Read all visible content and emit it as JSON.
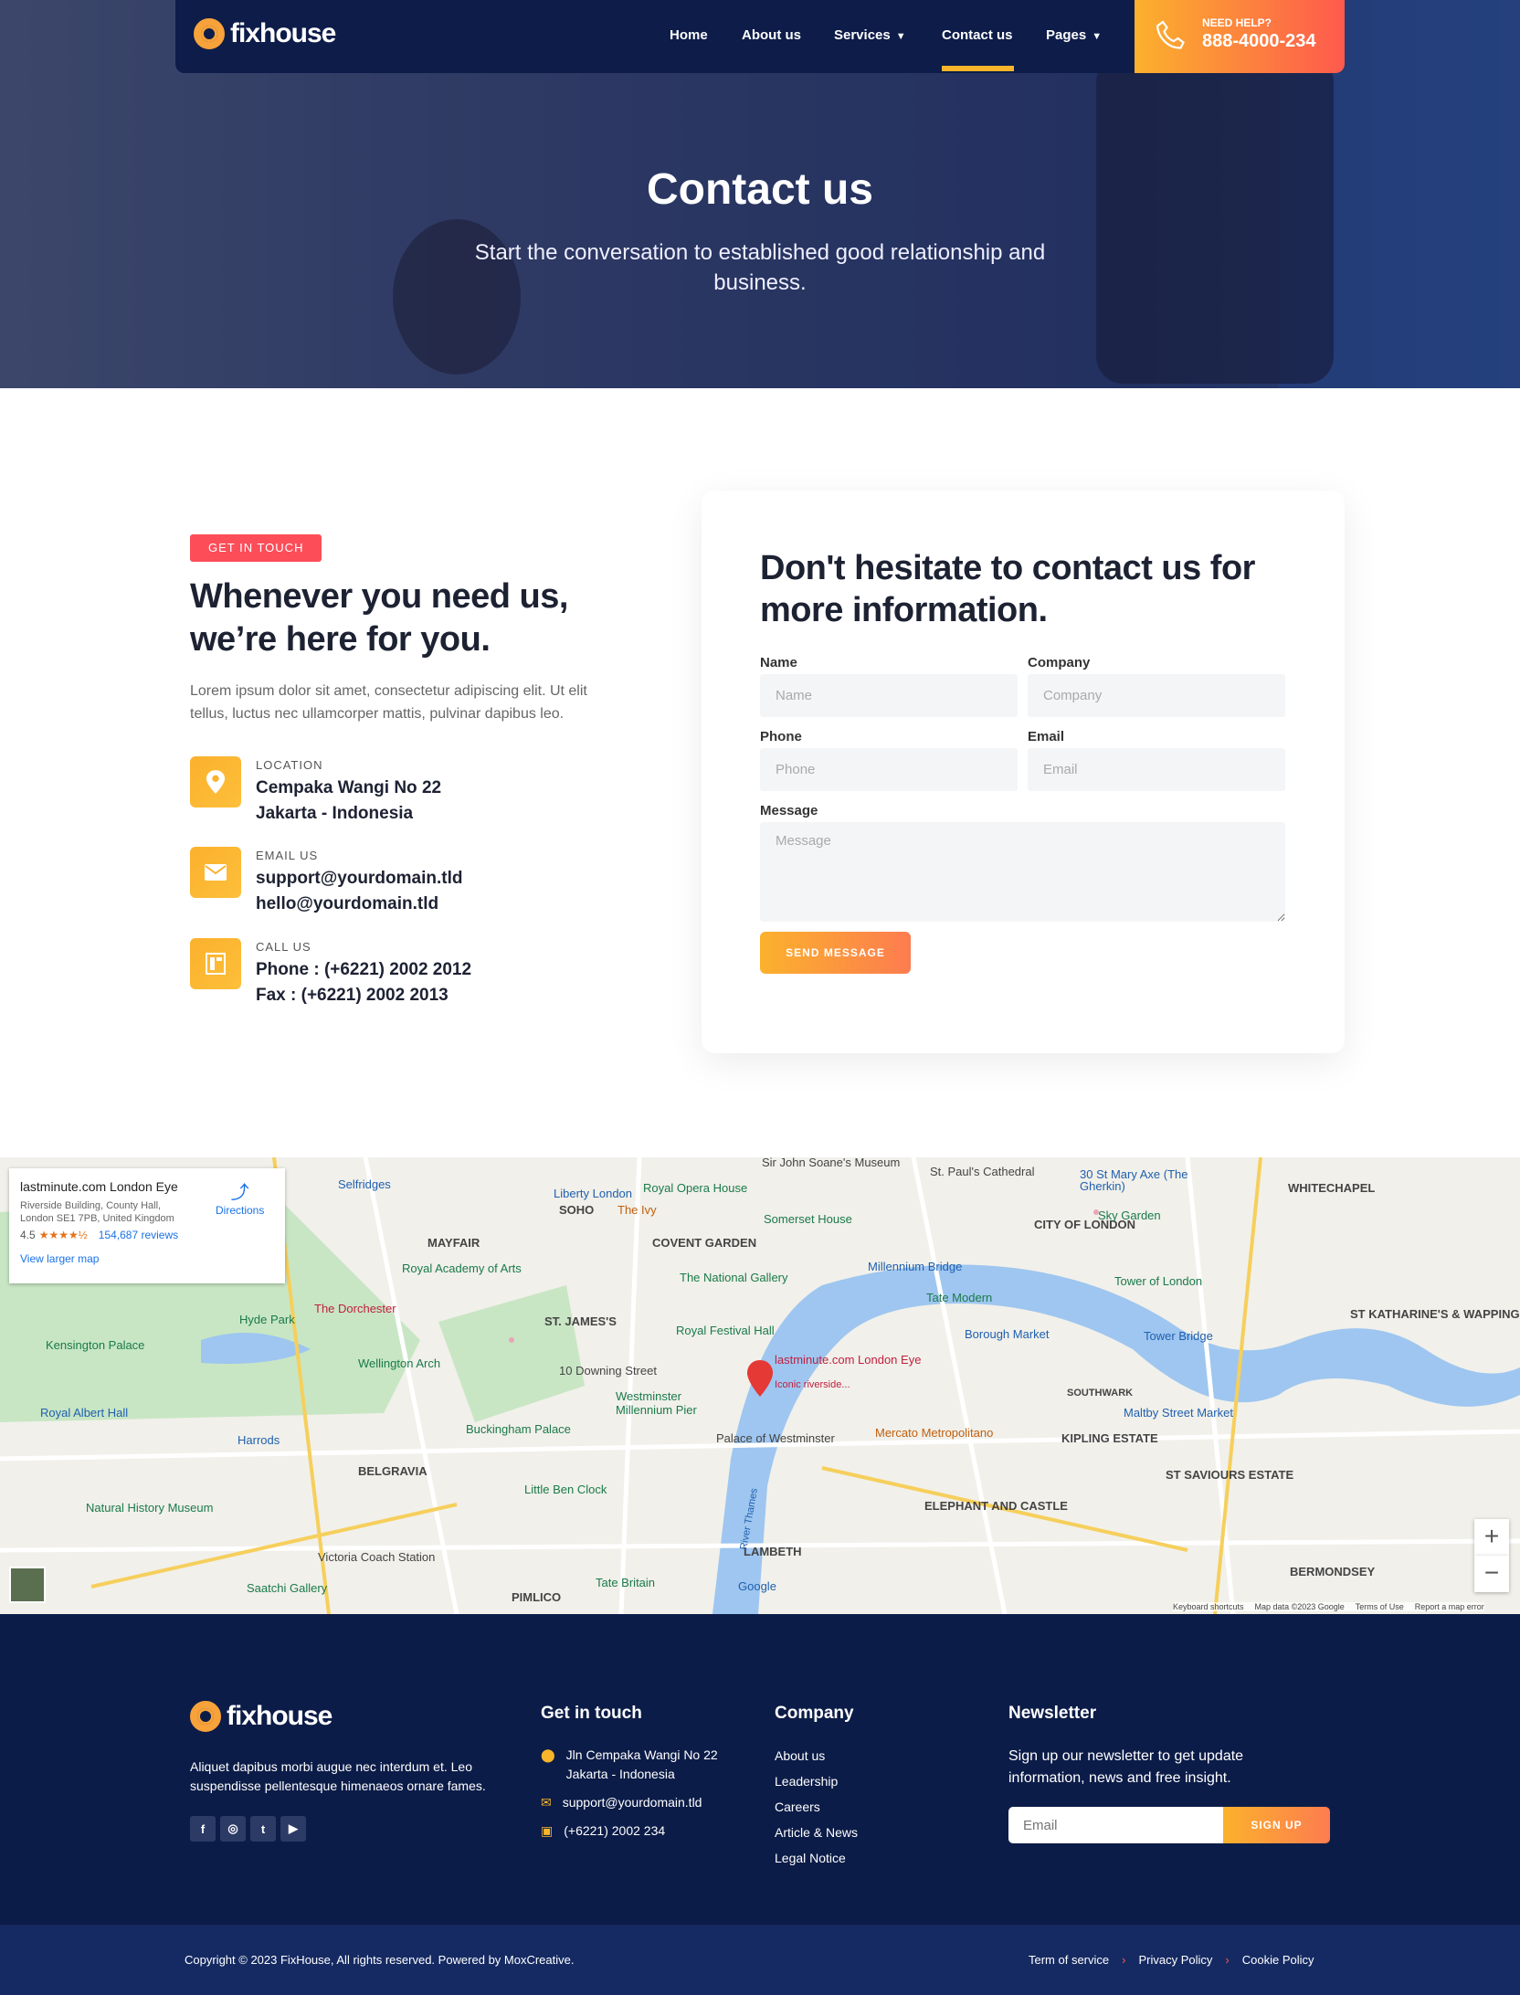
{
  "brand": {
    "name": "fixhouse",
    "accent": "#f8b52b",
    "navy": "#0d1c49",
    "cta_gradient": [
      "#fbb12d",
      "#fe5a4d"
    ]
  },
  "nav": {
    "items": [
      {
        "label": "Home"
      },
      {
        "label": "About us"
      },
      {
        "label": "Services",
        "dropdown": true
      },
      {
        "label": "Contact us",
        "active": true
      },
      {
        "label": "Pages",
        "dropdown": true
      }
    ],
    "cta": {
      "label": "NEED HELP?",
      "phone": "888-4000-234",
      "icon": "phone-icon"
    }
  },
  "hero": {
    "title": "Contact us",
    "subtitle": "Start the conversation to established good relationship and business."
  },
  "contact": {
    "badge": "GET IN TOUCH",
    "heading": "Whenever you need us, we’re here for you.",
    "paragraph": "Lorem ipsum dolor sit amet, consectetur adipiscing elit. Ut elit tellus, luctus nec ullamcorper mattis, pulvinar dapibus leo.",
    "items": [
      {
        "icon": "location-pin-icon",
        "label": "LOCATION",
        "lines": [
          "Cempaka Wangi No 22",
          "Jakarta - Indonesia"
        ]
      },
      {
        "icon": "envelope-icon",
        "label": "EMAIL US",
        "lines": [
          "support@yourdomain.tld",
          "hello@yourdomain.tld"
        ]
      },
      {
        "icon": "fax-icon",
        "label": "CALL US",
        "lines": [
          "Phone : (+6221) 2002 2012",
          "Fax : (+6221) 2002 2013"
        ]
      }
    ]
  },
  "form": {
    "heading": "Don't hesitate to contact us for more information.",
    "fields": {
      "name": {
        "label": "Name",
        "placeholder": "Name",
        "value": ""
      },
      "company": {
        "label": "Company",
        "placeholder": "Company",
        "value": ""
      },
      "phone": {
        "label": "Phone",
        "placeholder": "Phone",
        "value": ""
      },
      "email": {
        "label": "Email",
        "placeholder": "Email",
        "value": ""
      },
      "message": {
        "label": "Message",
        "placeholder": "Message",
        "value": ""
      }
    },
    "submit": "SEND MESSAGE"
  },
  "map": {
    "place": {
      "name": "lastminute.com London Eye",
      "address": [
        "Riverside Building, County Hall,",
        "London SE1 7PB, United Kingdom"
      ],
      "rating": "4.5",
      "stars": 4.5,
      "reviews": "154,687 reviews",
      "directions": "Directions",
      "larger": "View larger map"
    },
    "pin": {
      "name": "lastminute.com London Eye",
      "sub": "Iconic riverside..."
    },
    "labels": [
      "SOHO",
      "MAYFAIR",
      "COVENT GARDEN",
      "ST. JAMES'S",
      "BELGRAVIA",
      "CITY OF LONDON",
      "WHITECHAPEL",
      "LAMBETH",
      "ELEPHANT AND CASTLE",
      "KIPLING ESTATE",
      "ST SAVIOURS ESTATE",
      "BERMONDSEY",
      "SOUTHWARK",
      "ST KATHARINE'S & WAPPING",
      "PIMLICO"
    ],
    "green_labels": [
      "Hyde Park",
      "Kensington Palace",
      "Wellington Arch",
      "Royal Academy of Arts",
      "The National Gallery",
      "Buckingham Palace",
      "Little Ben Clock",
      "Natural History Museum",
      "Saatchi Gallery",
      "Tate Britain",
      "Tate Modern",
      "Sky Garden",
      "Tower of London",
      "Somerset House",
      "Royal Opera House",
      "Westminster Millennium Pier",
      "Royal Festival Hall"
    ],
    "blue_labels": [
      "Selfridges",
      "Liberty London",
      "Harrods",
      "Borough Market",
      "Maltby Street Market",
      "Royal Albert Hall",
      "Millennium Bridge",
      "Tower Bridge",
      "30 St Mary Axe (The Gherkin)",
      "St. Paul's Cathedral",
      "Sir John Soane's Museum",
      "10 Downing Street",
      "Palace of Westminster",
      "Victoria Coach Station"
    ],
    "red_labels": [
      "The Dorchester"
    ],
    "orange_labels": [
      "Mercato Metropolitano",
      "The Ivy"
    ],
    "footer_text": [
      "Keyboard shortcuts",
      "Map data ©2023 Google",
      "Terms of Use",
      "Report a map error"
    ],
    "google": "Google",
    "river": "River Thames"
  },
  "footer": {
    "about": "Aliquet dapibus morbi augue nec interdum et. Leo suspendisse pellentesque himenaeos ornare fames.",
    "social": [
      {
        "icon": "facebook-icon",
        "glyph": "f"
      },
      {
        "icon": "instagram-icon",
        "glyph": "◎"
      },
      {
        "icon": "twitter-icon",
        "glyph": "t"
      },
      {
        "icon": "youtube-icon",
        "glyph": "▶"
      }
    ],
    "touch": {
      "title": "Get in touch",
      "address": [
        "Jln Cempaka Wangi No 22",
        "Jakarta - Indonesia"
      ],
      "email": "support@yourdomain.tld",
      "phone": "(+6221) 2002 234"
    },
    "company": {
      "title": "Company",
      "links": [
        "About us",
        "Leadership",
        "Careers",
        "Article & News",
        "Legal Notice"
      ]
    },
    "newsletter": {
      "title": "Newsletter",
      "text": "Sign up our newsletter to get update information, news and free insight.",
      "placeholder": "Email",
      "button": "SIGN UP"
    },
    "copyright": "Copyright © 2023 FixHouse, All rights reserved. Powered by MoxCreative.",
    "legal": [
      "Term of service",
      "Privacy Policy",
      "Cookie Policy"
    ]
  }
}
